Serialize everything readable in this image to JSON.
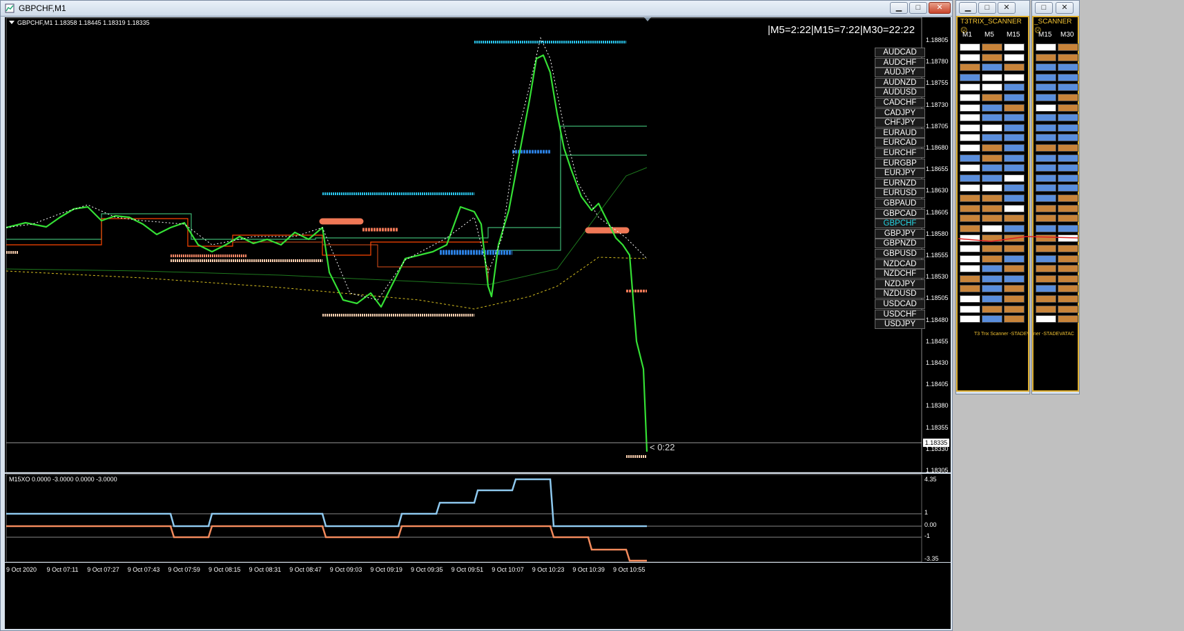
{
  "main_window": {
    "title": "GBPCHF,M1",
    "chart_header": "GBPCHF,M1  1.18358 1.18445 1.18319 1.18335",
    "timer_text": "|M5=2:22|M15=7:22|M30=22:22",
    "countdown": "< 0:22",
    "current_price": "1.18335",
    "price_ticks": [
      "1.18805",
      "1.18780",
      "1.18755",
      "1.18730",
      "1.18705",
      "1.18680",
      "1.18655",
      "1.18630",
      "1.18605",
      "1.18580",
      "1.18555",
      "1.18530",
      "1.18505",
      "1.18480",
      "1.18455",
      "1.18430",
      "1.18405",
      "1.18380",
      "1.18355",
      "1.18330",
      "1.18305"
    ],
    "time_ticks": [
      "9 Oct 2020",
      "9 Oct 07:11",
      "9 Oct 07:27",
      "9 Oct 07:43",
      "9 Oct 07:59",
      "9 Oct 08:15",
      "9 Oct 08:31",
      "9 Oct 08:47",
      "9 Oct 09:03",
      "9 Oct 09:19",
      "9 Oct 09:35",
      "9 Oct 09:51",
      "9 Oct 10:07",
      "9 Oct 10:23",
      "9 Oct 10:39",
      "9 Oct 10:55"
    ]
  },
  "indicator": {
    "header": "M15XO 0.0000 -3.0000 0.0000 -3.0000",
    "ticks": [
      "4.35",
      "1",
      "0.00",
      "-1",
      "-3.35"
    ]
  },
  "symbols": [
    "AUDCAD",
    "AUDCHF",
    "AUDJPY",
    "AUDNZD",
    "AUDUSD",
    "CADCHF",
    "CADJPY",
    "CHFJPY",
    "EURAUD",
    "EURCAD",
    "EURCHF",
    "EURGBP",
    "EURJPY",
    "EURNZD",
    "EURUSD",
    "GBPAUD",
    "GBPCAD",
    "GBPCHF",
    "GBPJPY",
    "GBPNZD",
    "GBPUSD",
    "NZDCAD",
    "NZDCHF",
    "NZDJPY",
    "NZDUSD",
    "USDCAD",
    "USDCHF",
    "USDJPY"
  ],
  "active_symbol": "GBPCHF",
  "scanner1": {
    "title": "T3TRIX_SCANNER",
    "columns": [
      "M1",
      "M5",
      "M15"
    ],
    "footer": "T3 Trix Scanner -STADEVATAC",
    "rows": [
      "wow",
      "wow",
      "obo",
      "bww",
      "wwb",
      "wob",
      "wbo",
      "wbb",
      "wwb",
      "wbb",
      "wob",
      "bob",
      "wbb",
      "bbw",
      "wwb",
      "oob",
      "oow",
      "ooo",
      "owb",
      "woo",
      "woo",
      "wob",
      "wbo",
      "obb",
      "obo",
      "wbo",
      "woo",
      "wbo"
    ]
  },
  "scanner2": {
    "title": "_SCANNER",
    "columns": [
      "M15",
      "M30"
    ],
    "footer": "ner -STADEVATAC",
    "rows": [
      "wo",
      "oo",
      "bb",
      "bb",
      "bb",
      "bo",
      "wo",
      "bb",
      "bb",
      "bb",
      "oo",
      "bb",
      "bb",
      "bb",
      "bb",
      "bo",
      "oo",
      "oo",
      "bb",
      "ow",
      "oo",
      "bo",
      "oo",
      "oo",
      "bo",
      "oo",
      "oo",
      "wo"
    ]
  },
  "colors": {
    "orange": "#c8843a",
    "blue": "#5a8edc",
    "frame": "#e0b030"
  }
}
